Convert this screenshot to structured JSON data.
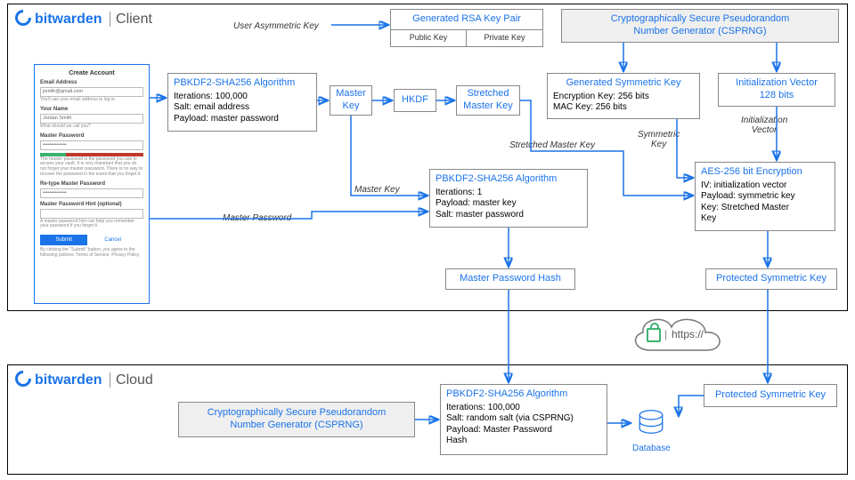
{
  "regions": {
    "client": "Client",
    "cloud": "Cloud",
    "brand": "bitwarden"
  },
  "edgeLabels": {
    "userAsymKey": "User Asymmetric Key",
    "stretchedMasterKey": "Stretched Master Key",
    "masterKey": "Master Key",
    "masterPassword": "Master Password",
    "symmetricKey": "Symmetric\nKey",
    "initVector": "Initialization\nVector"
  },
  "client": {
    "pbkdf1": {
      "title": "PBKDF2-SHA256 Algorithm",
      "l1": "Iterations: 100,000",
      "l2": "Salt: email address",
      "l3": "Payload: master password"
    },
    "masterKey": {
      "title": "Master\nKey"
    },
    "hkdf": {
      "title": "HKDF"
    },
    "stretched": {
      "title": "Stretched\nMaster Key"
    },
    "rsa": {
      "title": "Generated RSA Key Pair",
      "pub": "Public Key",
      "priv": "Private Key"
    },
    "csprng": {
      "title": "Cryptographically Secure Pseudorandom\nNumber Generator (CSPRNG)"
    },
    "symKey": {
      "title": "Generated Symmetric Key",
      "l1": "Encryption Key: 256 bits",
      "l2": "MAC Key: 256 bits"
    },
    "iv": {
      "title": "Initialization Vector\n128 bits"
    },
    "pbkdf2": {
      "title": "PBKDF2-SHA256 Algorithm",
      "l1": "Iterations: 1",
      "l2": "Payload: master key",
      "l3": "Salt: master password"
    },
    "aes": {
      "title": "AES-256 bit Encryption",
      "l1": "IV: initialization vector",
      "l2": "Payload: symmetric key",
      "l3": "Key: Stretched Master",
      "l4": "Key"
    },
    "mph": {
      "title": "Master Password Hash"
    },
    "psk": {
      "title": "Protected Symmetric Key"
    }
  },
  "cloud": {
    "csprng": {
      "title": "Cryptographically Secure Pseudorandom\nNumber Generator (CSPRNG)"
    },
    "pbkdf": {
      "title": "PBKDF2-SHA256 Algorithm",
      "l1": "Iterations: 100,000",
      "l2": "Salt: random salt (via CSPRNG)",
      "l3": "Payload: Master Password",
      "l4": "Hash"
    },
    "psk": {
      "title": "Protected Symmetric Key"
    },
    "db": "Database",
    "https": "https://"
  },
  "createAccount": {
    "heading": "Create Account",
    "emailLbl": "Email Address",
    "emailVal": "jsmith@gmail.com",
    "emailHelp": "You'll use your email address to log in.",
    "nameLbl": "Your Name",
    "nameVal": "Jordan Smith",
    "nameHelp": "What should we call you?",
    "mpLbl": "Master Password",
    "mpVal": "••••••••••••••",
    "mpHelp": "The master password is the password you use to access your vault. It is very important that you do not forget your master password. There is no way to recover the password in the event that you forget it.",
    "retypeLbl": "Re-type Master Password",
    "retypeVal": "••••••••••••••",
    "hintLbl": "Master Password Hint (optional)",
    "hintHelp": "A master password hint can help you remember your password if you forget it.",
    "submit": "Submit",
    "cancel": "Cancel",
    "tos": "By clicking the \"Submit\" button, you agree to the following policies: Terms of Service, Privacy Policy"
  }
}
